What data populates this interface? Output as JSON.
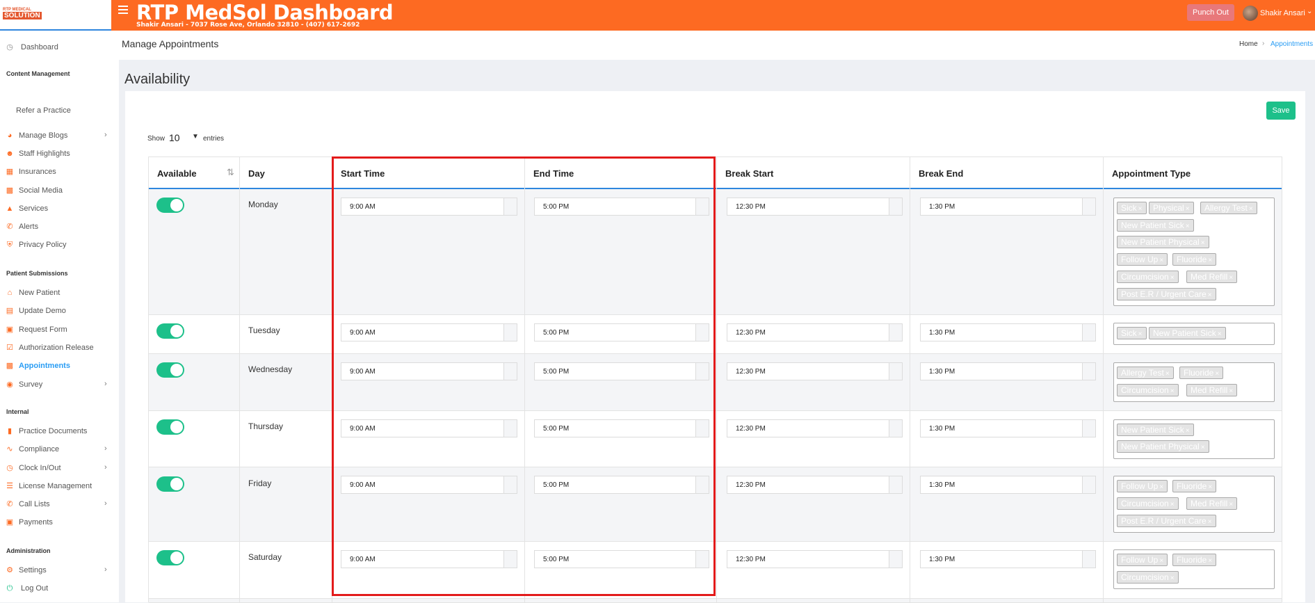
{
  "header": {
    "logo_top": "RTP MEDICAL",
    "logo_bottom": "SOLUTION",
    "title": "RTP MedSol Dashboard",
    "subtitle": "Shakir Ansari - 7037 Rose Ave, Orlando 32810 - (407) 617-2692",
    "punch_label": "Punch Out",
    "user_name": "Shakir Ansari",
    "accent_color": "#fd6a22"
  },
  "sidebar": {
    "items": [
      {
        "label": "Dashboard",
        "icon": "dashboard-icon"
      },
      {
        "label": "Content Management"
      },
      {
        "label": "Refer a Practice"
      },
      {
        "label": "Manage Blogs",
        "icon": "rss-icon"
      },
      {
        "label": "Staff Highlights",
        "icon": "user-icon"
      },
      {
        "label": "Insurances",
        "icon": "insurance-icon"
      },
      {
        "label": "Social Media",
        "icon": "share-icon"
      },
      {
        "label": "Services",
        "icon": "services-icon"
      },
      {
        "label": "Alerts",
        "icon": "phone-icon"
      },
      {
        "label": "Privacy Policy",
        "icon": "shield-icon"
      },
      {
        "label": "Patient Submissions"
      },
      {
        "label": "New Patient",
        "icon": "home-icon"
      },
      {
        "label": "Update Demo",
        "icon": "id-card-icon"
      },
      {
        "label": "Request Form",
        "icon": "form-icon"
      },
      {
        "label": "Authorization Release",
        "icon": "check-doc-icon"
      },
      {
        "label": "Appointments",
        "icon": "calendar-icon"
      },
      {
        "label": "Survey",
        "icon": "survey-icon"
      },
      {
        "label": "Internal"
      },
      {
        "label": "Practice Documents",
        "icon": "clipboard-icon"
      },
      {
        "label": "Compliance",
        "icon": "signature-icon"
      },
      {
        "label": "Clock In/Out",
        "icon": "clock-icon"
      },
      {
        "label": "License Management",
        "icon": "list-icon"
      },
      {
        "label": "Call Lists",
        "icon": "phone-icon"
      },
      {
        "label": "Payments",
        "icon": "money-icon"
      },
      {
        "label": "Administration"
      },
      {
        "label": "Settings",
        "icon": "gear-icon"
      },
      {
        "label": "Log Out",
        "icon": "power-icon"
      }
    ]
  },
  "page": {
    "title": "Manage Appointments",
    "breadcrumb_home": "Home",
    "breadcrumb_current": "Appointments",
    "section_title": "Availability",
    "save_label": "Save",
    "show_label": "Show",
    "entries_value": "10",
    "entries_label": "entries"
  },
  "table": {
    "columns": [
      "Available",
      "Day",
      "Start Time",
      "End Time",
      "Break Start",
      "Break End",
      "Appointment Type"
    ],
    "rows": [
      {
        "day": "Monday",
        "available": true,
        "start": "9:00 AM",
        "end": "5:00 PM",
        "break_start": "12:30 PM",
        "break_end": "1:30 PM",
        "types": [
          "Sick",
          "Physical",
          "Allergy Test",
          "New Patient Sick",
          "New Patient Physical",
          "Follow Up",
          "Fluoride",
          "Circumcision",
          "Med Refill",
          "Post E.R / Urgent Care"
        ]
      },
      {
        "day": "Tuesday",
        "available": true,
        "start": "9:00 AM",
        "end": "5:00 PM",
        "break_start": "12:30 PM",
        "break_end": "1:30 PM",
        "types": [
          "Sick",
          "New Patient Sick"
        ]
      },
      {
        "day": "Wednesday",
        "available": true,
        "start": "9:00 AM",
        "end": "5:00 PM",
        "break_start": "12:30 PM",
        "break_end": "1:30 PM",
        "types": [
          "Allergy Test",
          "Fluoride",
          "Circumcision",
          "Med Refill"
        ]
      },
      {
        "day": "Thursday",
        "available": true,
        "start": "9:00 AM",
        "end": "5:00 PM",
        "break_start": "12:30 PM",
        "break_end": "1:30 PM",
        "types": [
          "New Patient Sick",
          "New Patient Physical"
        ]
      },
      {
        "day": "Friday",
        "available": true,
        "start": "9:00 AM",
        "end": "5:00 PM",
        "break_start": "12:30 PM",
        "break_end": "1:30 PM",
        "types": [
          "Follow Up",
          "Fluoride",
          "Circumcision",
          "Med Refill",
          "Post E.R / Urgent Care"
        ]
      },
      {
        "day": "Saturday",
        "available": true,
        "start": "9:00 AM",
        "end": "5:00 PM",
        "break_start": "12:30 PM",
        "break_end": "1:30 PM",
        "types": [
          "Follow Up",
          "Fluoride",
          "Circumcision"
        ]
      }
    ]
  },
  "colors": {
    "toggle_on": "#1dc08a",
    "highlight_box": "#e31b1b",
    "link": "#2a9df4"
  }
}
